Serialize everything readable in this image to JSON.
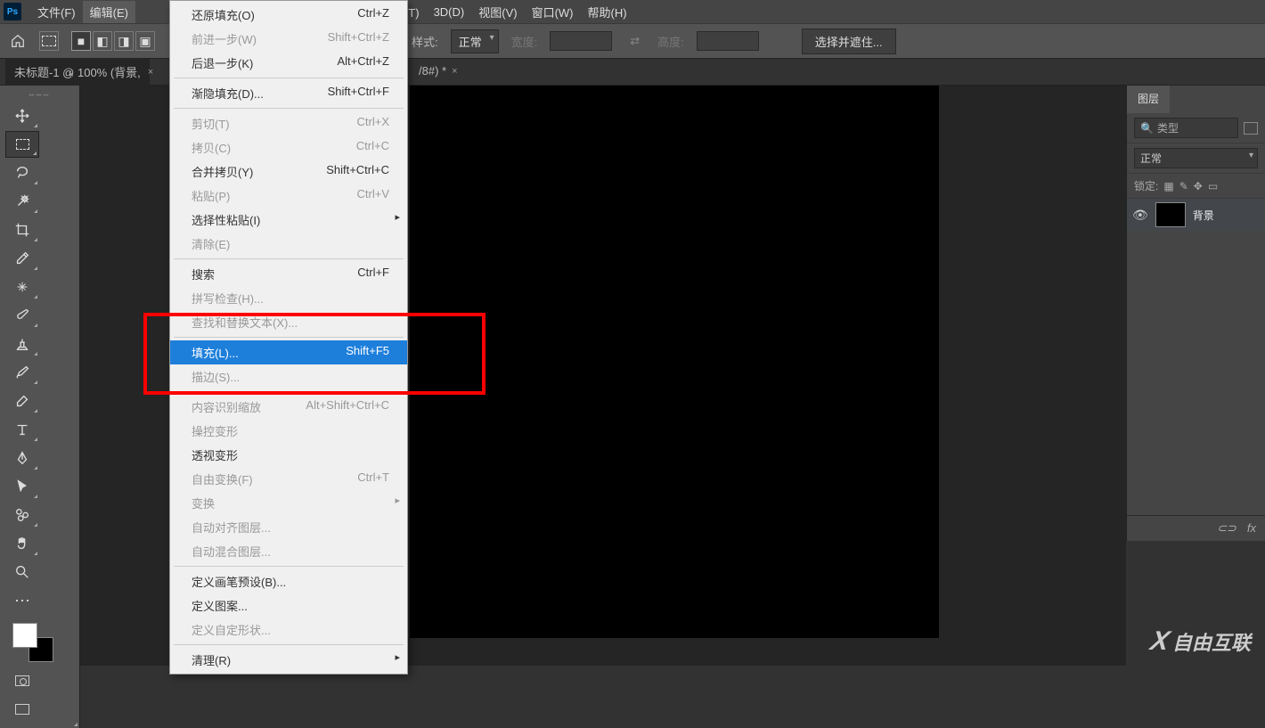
{
  "menubar": {
    "logo": "Ps",
    "items": [
      "文件(F)",
      "编辑(E)",
      "",
      "",
      "",
      "滤镜(T)",
      "3D(D)",
      "视图(V)",
      "窗口(W)",
      "帮助(H)"
    ]
  },
  "optbar": {
    "style_label": "样式:",
    "style_value": "正常",
    "width_label": "宽度:",
    "height_label": "高度:",
    "mask_button": "选择并遮住..."
  },
  "tabs": {
    "tab1": "未标题-1 @ 100% (背景,",
    "tab2": "/8#) *",
    "close": "×"
  },
  "layers": {
    "tab": "图层",
    "search_placeholder": "类型",
    "blend_mode": "正常",
    "lock_label": "锁定:",
    "layer_name": "背景",
    "footer_link": "⊂⊃",
    "footer_fx": "fx"
  },
  "edit_menu": [
    {
      "label": "还原填充(O)",
      "shortcut": "Ctrl+Z"
    },
    {
      "label": "前进一步(W)",
      "shortcut": "Shift+Ctrl+Z",
      "disabled": true
    },
    {
      "label": "后退一步(K)",
      "shortcut": "Alt+Ctrl+Z"
    },
    {
      "sep": true
    },
    {
      "label": "渐隐填充(D)...",
      "shortcut": "Shift+Ctrl+F"
    },
    {
      "sep": true
    },
    {
      "label": "剪切(T)",
      "shortcut": "Ctrl+X",
      "disabled": true
    },
    {
      "label": "拷贝(C)",
      "shortcut": "Ctrl+C",
      "disabled": true
    },
    {
      "label": "合并拷贝(Y)",
      "shortcut": "Shift+Ctrl+C"
    },
    {
      "label": "粘贴(P)",
      "shortcut": "Ctrl+V",
      "disabled": true
    },
    {
      "label": "选择性粘贴(I)",
      "sub": true
    },
    {
      "label": "清除(E)",
      "disabled": true
    },
    {
      "sep": true
    },
    {
      "label": "搜索",
      "shortcut": "Ctrl+F"
    },
    {
      "label": "拼写检查(H)...",
      "disabled": true
    },
    {
      "label": "查找和替换文本(X)...",
      "disabled": true
    },
    {
      "sep": true
    },
    {
      "label": "填充(L)...",
      "shortcut": "Shift+F5",
      "highlight": true
    },
    {
      "label": "描边(S)...",
      "disabled": true
    },
    {
      "sep": true
    },
    {
      "label": "内容识别缩放",
      "shortcut": "Alt+Shift+Ctrl+C",
      "disabled": true
    },
    {
      "label": "操控变形",
      "disabled": true
    },
    {
      "label": "透视变形"
    },
    {
      "label": "自由变换(F)",
      "shortcut": "Ctrl+T",
      "disabled": true
    },
    {
      "label": "变换",
      "sub": true,
      "disabled": true
    },
    {
      "label": "自动对齐图层...",
      "disabled": true
    },
    {
      "label": "自动混合图层...",
      "disabled": true
    },
    {
      "sep": true
    },
    {
      "label": "定义画笔预设(B)..."
    },
    {
      "label": "定义图案..."
    },
    {
      "label": "定义自定形状...",
      "disabled": true
    },
    {
      "sep": true
    },
    {
      "label": "清理(R)",
      "sub": true
    }
  ],
  "watermark": "自由互联"
}
